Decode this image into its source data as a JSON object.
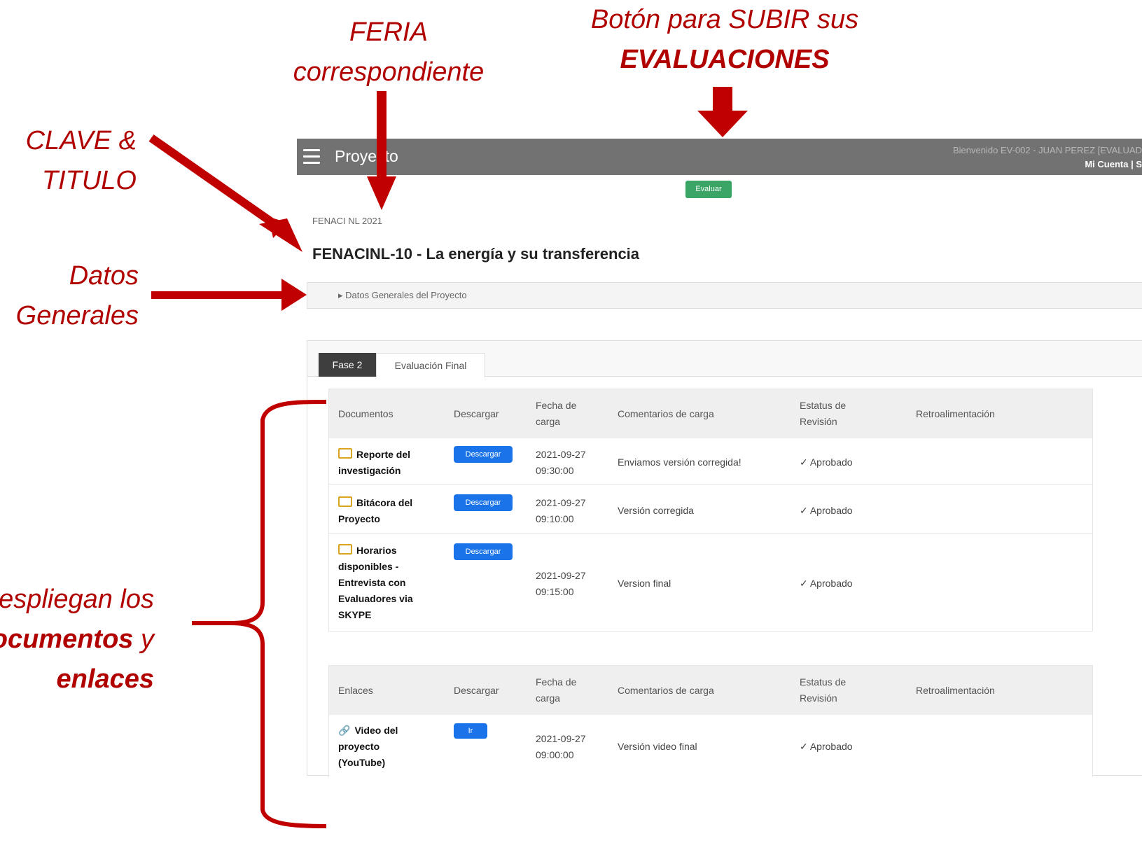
{
  "annotations": {
    "feria": [
      "FERIA",
      "correspondiente"
    ],
    "boton": [
      "Botón para SUBIR sus",
      "EVALUACIONES"
    ],
    "clave": [
      "CLAVE &",
      "TITULO"
    ],
    "datos": [
      "Datos",
      "Generales"
    ],
    "despliegan": [
      "espliegan los",
      "ocumentos",
      "y",
      "enlaces"
    ]
  },
  "topbar": {
    "title": "Proyecto",
    "welcome": "Bienvenido EV-002 - JUAN PEREZ [EVALUAD",
    "account_links": "Mi Cuenta | S"
  },
  "evaluate_button": "Evaluar",
  "fair": "FENACI NL 2021",
  "project_title": "FENACINL-10 - La energía y su transferencia",
  "general_data_toggle": "▸ Datos Generales del Proyecto",
  "tabs": [
    {
      "label": "Fase 2",
      "active": true
    },
    {
      "label": "Evaluación Final",
      "active": false
    }
  ],
  "documents_table": {
    "headers": [
      "Documentos",
      "Descargar",
      [
        "Fecha de",
        "carga"
      ],
      "Comentarios de carga",
      [
        "Estatus de",
        "Revisión"
      ],
      "Retroalimentación"
    ],
    "rows": [
      {
        "name": [
          "Reporte del",
          "investigación"
        ],
        "button": "Descargar",
        "date": [
          "2021-09-27",
          "09:30:00"
        ],
        "comment": "Enviamos versión corregida!",
        "status": "✓ Aprobado"
      },
      {
        "name": [
          "Bitácora del",
          "Proyecto"
        ],
        "button": "Descargar",
        "date": [
          "2021-09-27",
          "09:10:00"
        ],
        "comment": "Versión corregida",
        "status": "✓ Aprobado"
      },
      {
        "name": [
          "Horarios",
          "disponibles -",
          "Entrevista con",
          "Evaluadores via",
          "SKYPE"
        ],
        "button": "Descargar",
        "date": [
          "2021-09-27",
          "09:15:00"
        ],
        "comment": "Version final",
        "status": "✓ Aprobado"
      }
    ]
  },
  "links_table": {
    "headers": [
      "Enlaces",
      "Descargar",
      [
        "Fecha de",
        "carga"
      ],
      "Comentarios de carga",
      [
        "Estatus de",
        "Revisión"
      ],
      "Retroalimentación"
    ],
    "rows": [
      {
        "name": [
          "Video del",
          "proyecto",
          "(YouTube)"
        ],
        "button": "Ir",
        "date": [
          "2021-09-27",
          "09:00:00"
        ],
        "comment": "Versión video final",
        "status": "✓ Aprobado"
      }
    ]
  },
  "colors": {
    "annotation": "#b00000",
    "topbar": "#727272",
    "evaluate_button": "#3aa565",
    "download_button": "#1a73e8",
    "active_tab": "#3e3e3e"
  }
}
